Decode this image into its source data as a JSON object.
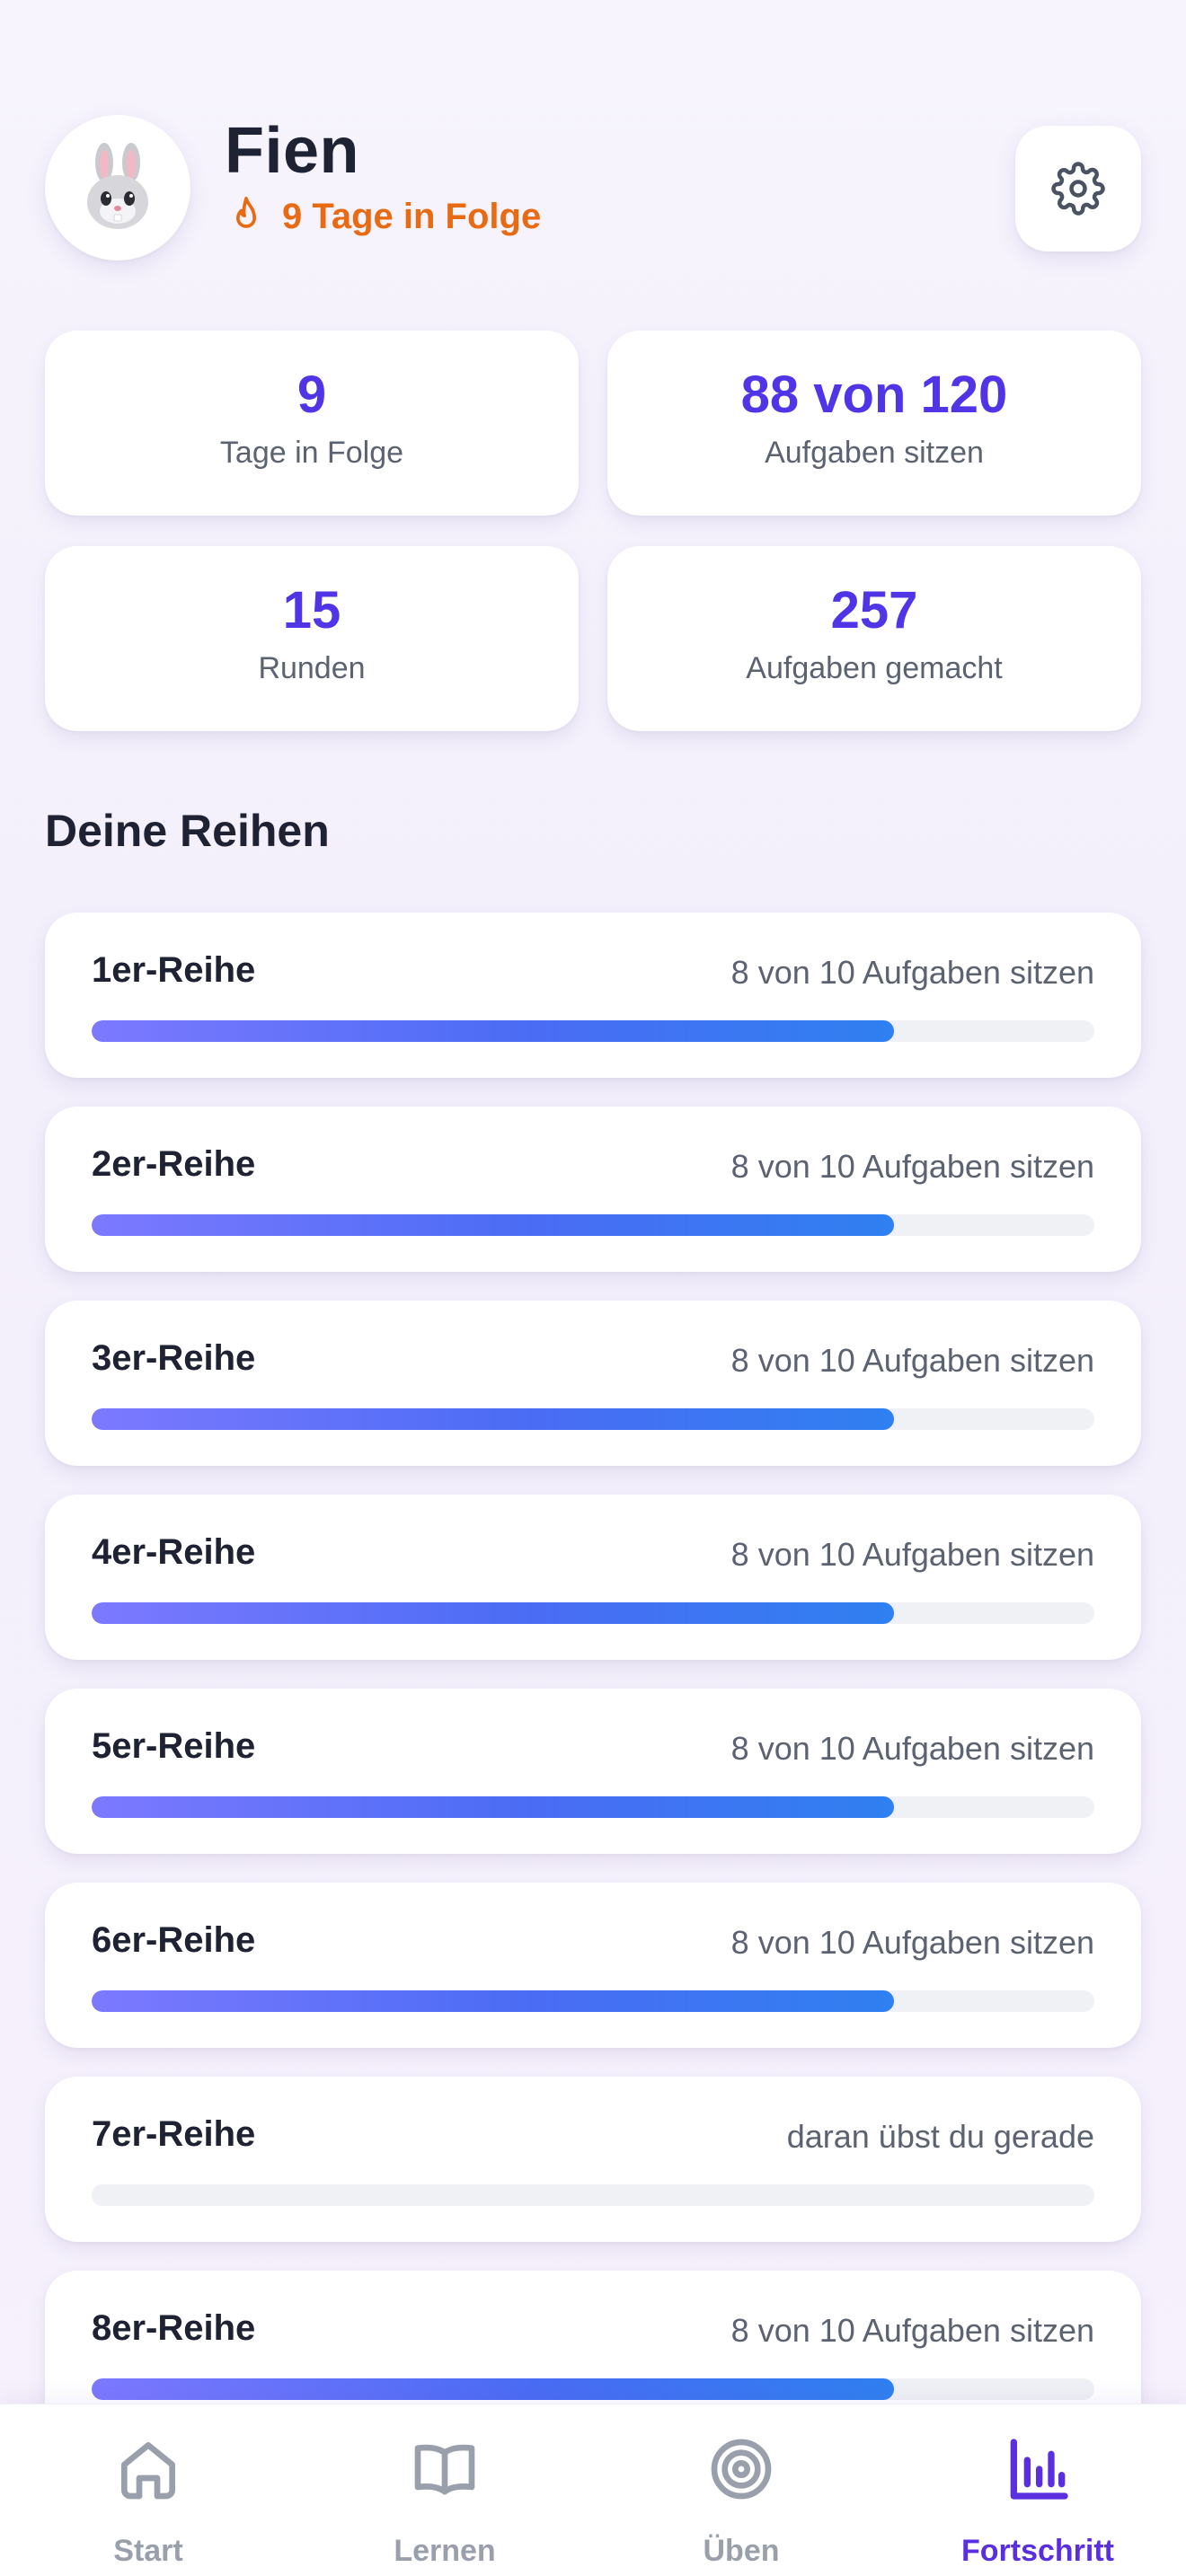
{
  "profile": {
    "name": "Fien",
    "streak_text": "9 Tage in Folge",
    "avatar_icon": "bunny-icon",
    "settings_icon": "gear-icon"
  },
  "colors": {
    "accent": "#4f35e6",
    "streak": "#e86a12",
    "nav_active": "#5a2fe0",
    "nav_inactive": "#9aa0ab",
    "progress_start": "#7c79ff",
    "progress_end": "#2f80f0"
  },
  "stats": [
    {
      "value": "9",
      "label": "Tage in Folge"
    },
    {
      "value": "88 von 120",
      "label": "Aufgaben sitzen"
    },
    {
      "value": "15",
      "label": "Runden"
    },
    {
      "value": "257",
      "label": "Aufgaben gemacht"
    }
  ],
  "section_title": "Deine Reihen",
  "series": [
    {
      "name": "1er-Reihe",
      "status": "8 von 10 Aufgaben sitzen",
      "progress": 0.8
    },
    {
      "name": "2er-Reihe",
      "status": "8 von 10 Aufgaben sitzen",
      "progress": 0.8
    },
    {
      "name": "3er-Reihe",
      "status": "8 von 10 Aufgaben sitzen",
      "progress": 0.8
    },
    {
      "name": "4er-Reihe",
      "status": "8 von 10 Aufgaben sitzen",
      "progress": 0.8
    },
    {
      "name": "5er-Reihe",
      "status": "8 von 10 Aufgaben sitzen",
      "progress": 0.8
    },
    {
      "name": "6er-Reihe",
      "status": "8 von 10 Aufgaben sitzen",
      "progress": 0.8
    },
    {
      "name": "7er-Reihe",
      "status": "daran übst du gerade",
      "progress": 0
    },
    {
      "name": "8er-Reihe",
      "status": "8 von 10 Aufgaben sitzen",
      "progress": 0.8
    }
  ],
  "nav": [
    {
      "label": "Start",
      "icon": "home-icon",
      "active": false
    },
    {
      "label": "Lernen",
      "icon": "book-icon",
      "active": false
    },
    {
      "label": "Üben",
      "icon": "target-icon",
      "active": false
    },
    {
      "label": "Fortschritt",
      "icon": "bar-chart-icon",
      "active": true
    }
  ]
}
